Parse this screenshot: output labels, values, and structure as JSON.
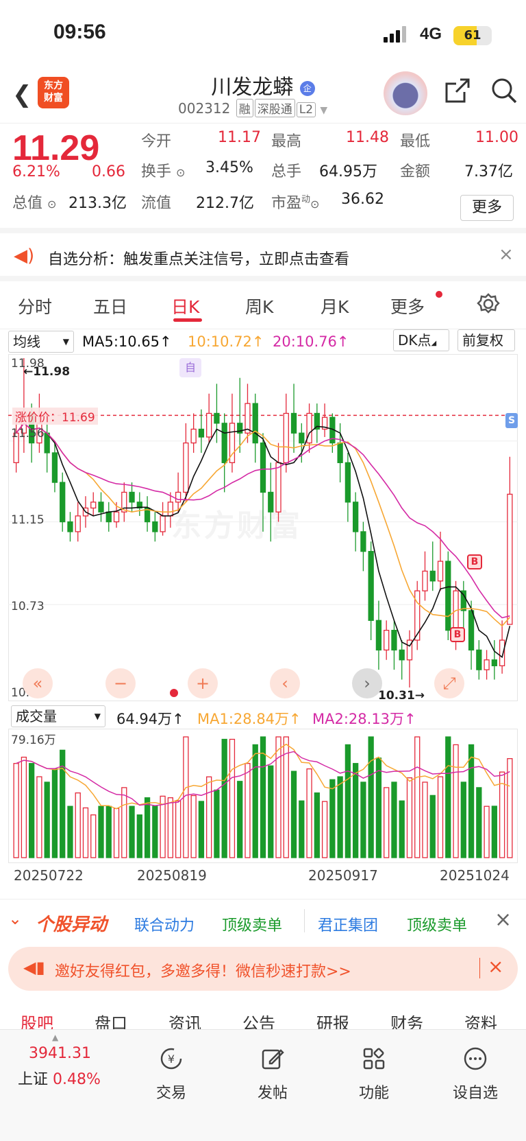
{
  "status": {
    "time": "09:56",
    "network": "4G",
    "battery": "61",
    "battery_level": 0.61
  },
  "header": {
    "title": "川发龙蟒",
    "badge": "企",
    "code": "002312",
    "tags": [
      "融",
      "深股通",
      "L2"
    ],
    "logo_text_1": "东方",
    "logo_text_2": "财富"
  },
  "quote": {
    "price": "11.29",
    "pct": "6.21%",
    "change": "0.66",
    "open_label": "今开",
    "open": "11.17",
    "high_label": "最高",
    "high": "11.48",
    "low_label": "最低",
    "low": "11.00",
    "turnover_label": "换手",
    "turnover": "3.45%",
    "volume_label": "总手",
    "volume": "64.95万",
    "amount_label": "金额",
    "amount": "7.37亿",
    "mktcap_label": "总值",
    "mktcap": "213.3亿",
    "float_label": "流值",
    "float": "212.7亿",
    "pe_label": "市盈",
    "pe_sup": "动",
    "pe": "36.62",
    "more": "更多"
  },
  "notice": {
    "text": "自选分析：触发重点关注信号，立即点击查看"
  },
  "tabs": [
    "分时",
    "五日",
    "日K",
    "周K",
    "月K",
    "更多"
  ],
  "indicator": {
    "select": "均线",
    "ma5": "MA5:10.65",
    "ma10": "10:10.72",
    "ma20": "20:10.76",
    "dk": "DK点",
    "adjust": "前复权"
  },
  "chart": {
    "y_labels": [
      "11.98",
      "11.56",
      "11.15",
      "10.73",
      "10.31"
    ],
    "max_label": "11.98",
    "min_label": "10.31",
    "alert_label": "涨价价：11.69",
    "zi": "自",
    "b": "B",
    "s": "S",
    "watermark": "东方财富"
  },
  "volume": {
    "select": "成交量",
    "vol": "64.94万",
    "ma1": "MA1:28.84万",
    "ma2": "MA2:28.13万",
    "top_label": "79.16万"
  },
  "dates": [
    "20250722",
    "20250819",
    "20250917",
    "20251024"
  ],
  "yidong": {
    "title": "个股异动",
    "items": [
      {
        "label": "联合动力",
        "color": "blue"
      },
      {
        "label": "顶级卖单",
        "color": "green"
      },
      {
        "label": "君正集团",
        "color": "blue"
      },
      {
        "label": "顶级卖单",
        "color": "green"
      }
    ]
  },
  "invite": {
    "text": "邀好友得红包，多邀多得！微信秒速打款>>"
  },
  "subtabs": [
    "股吧",
    "盘口",
    "资讯",
    "公告",
    "研报",
    "财务",
    "资料"
  ],
  "bottom": {
    "index_value": "3941.31",
    "index_name": "上证",
    "index_pct": "0.48%",
    "items": [
      "交易",
      "发帖",
      "功能",
      "设自选"
    ]
  },
  "colors": {
    "up": "#e4283a",
    "down": "#1a9a2b",
    "ma5": "#111111",
    "ma10": "#f7a733",
    "ma20": "#d42aa5"
  },
  "chart_data": {
    "type": "candlestick",
    "y_range": [
      10.31,
      11.98
    ],
    "start_date": "20250722",
    "date_ticks": [
      "20250722",
      "20250819",
      "20250917",
      "20251024"
    ],
    "candles": [
      [
        11.45,
        11.6,
        11.7,
        11.4
      ],
      [
        11.6,
        11.7,
        11.98,
        11.5
      ],
      [
        11.7,
        11.55,
        11.75,
        11.45
      ],
      [
        11.55,
        11.65,
        11.8,
        11.5
      ],
      [
        11.6,
        11.5,
        11.65,
        11.4
      ],
      [
        11.5,
        11.35,
        11.55,
        11.3
      ],
      [
        11.35,
        11.15,
        11.4,
        11.1
      ],
      [
        11.15,
        11.1,
        11.2,
        11.05
      ],
      [
        11.1,
        11.18,
        11.25,
        11.05
      ],
      [
        11.18,
        11.22,
        11.28,
        11.12
      ],
      [
        11.22,
        11.25,
        11.3,
        11.18
      ],
      [
        11.25,
        11.2,
        11.3,
        11.15
      ],
      [
        11.2,
        11.15,
        11.25,
        11.1
      ],
      [
        11.15,
        11.2,
        11.25,
        11.12
      ],
      [
        11.2,
        11.3,
        11.35,
        11.15
      ],
      [
        11.3,
        11.25,
        11.35,
        11.2
      ],
      [
        11.25,
        11.22,
        11.3,
        11.18
      ],
      [
        11.22,
        11.15,
        11.28,
        11.1
      ],
      [
        11.15,
        11.1,
        11.2,
        11.05
      ],
      [
        11.1,
        11.18,
        11.25,
        11.08
      ],
      [
        11.18,
        11.25,
        11.3,
        11.12
      ],
      [
        11.25,
        11.3,
        11.4,
        11.2
      ],
      [
        11.3,
        11.55,
        11.65,
        11.25
      ],
      [
        11.55,
        11.62,
        11.7,
        11.5
      ],
      [
        11.62,
        11.58,
        11.72,
        11.5
      ],
      [
        11.58,
        11.7,
        11.8,
        11.55
      ],
      [
        11.7,
        11.65,
        11.85,
        11.55
      ],
      [
        11.65,
        11.45,
        11.7,
        11.3
      ],
      [
        11.45,
        11.65,
        11.8,
        11.4
      ],
      [
        11.65,
        11.6,
        11.88,
        11.5
      ],
      [
        11.6,
        11.75,
        11.85,
        11.55
      ],
      [
        11.75,
        11.55,
        11.8,
        11.45
      ],
      [
        11.55,
        11.3,
        11.6,
        11.1
      ],
      [
        11.3,
        11.2,
        11.45,
        11.05
      ],
      [
        11.2,
        11.45,
        11.55,
        11.15
      ],
      [
        11.45,
        11.7,
        11.8,
        11.4
      ],
      [
        11.7,
        11.6,
        11.85,
        11.5
      ],
      [
        11.6,
        11.55,
        11.65,
        11.45
      ],
      [
        11.55,
        11.7,
        11.75,
        11.5
      ],
      [
        11.7,
        11.62,
        11.75,
        11.55
      ],
      [
        11.62,
        11.68,
        11.75,
        11.58
      ],
      [
        11.68,
        11.55,
        11.7,
        11.5
      ],
      [
        11.55,
        11.45,
        11.65,
        11.35
      ],
      [
        11.45,
        11.25,
        11.5,
        11.15
      ],
      [
        11.25,
        11.1,
        11.3,
        11.0
      ],
      [
        11.1,
        11.0,
        11.15,
        10.9
      ],
      [
        11.0,
        10.65,
        11.05,
        10.55
      ],
      [
        10.65,
        10.5,
        10.75,
        10.4
      ],
      [
        10.5,
        10.6,
        10.65,
        10.45
      ],
      [
        10.6,
        10.5,
        10.65,
        10.4
      ],
      [
        10.5,
        10.45,
        10.55,
        10.35
      ],
      [
        10.45,
        10.55,
        10.6,
        10.31
      ],
      [
        10.55,
        10.8,
        10.85,
        10.5
      ],
      [
        10.8,
        10.9,
        11.0,
        10.75
      ],
      [
        10.9,
        10.85,
        11.05,
        10.8
      ],
      [
        10.85,
        10.95,
        11.1,
        10.8
      ],
      [
        10.95,
        10.6,
        11.0,
        10.55
      ],
      [
        10.6,
        10.8,
        10.85,
        10.5
      ],
      [
        10.8,
        10.7,
        10.85,
        10.6
      ],
      [
        10.7,
        10.5,
        10.75,
        10.4
      ],
      [
        10.5,
        10.4,
        10.55,
        10.35
      ],
      [
        10.4,
        10.45,
        10.5,
        10.35
      ],
      [
        10.45,
        10.42,
        10.55,
        10.35
      ],
      [
        10.42,
        10.55,
        10.65,
        10.38
      ],
      [
        10.63,
        11.29,
        11.48,
        11.0
      ]
    ]
  }
}
